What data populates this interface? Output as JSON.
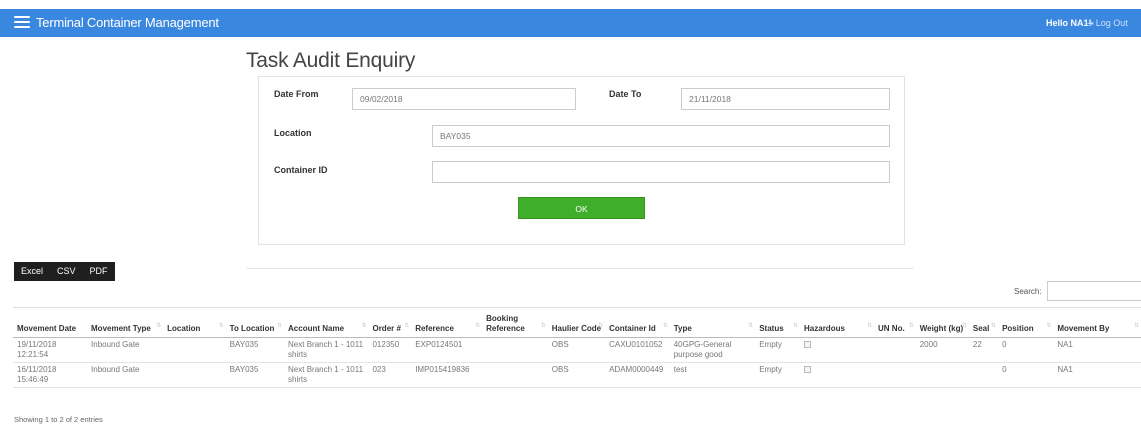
{
  "nav": {
    "brand": "Terminal Container Management",
    "greeting": "Hello NA1!",
    "logout": "Log Out"
  },
  "page": {
    "title": "Task Audit Enquiry"
  },
  "form": {
    "date_from_label": "Date From",
    "date_from_value": "09/02/2018",
    "date_to_label": "Date To",
    "date_to_value": "21/11/2018",
    "location_label": "Location",
    "location_value": "BAY035",
    "container_label": "Container ID",
    "container_value": "",
    "ok_label": "OK"
  },
  "export": {
    "excel": "Excel",
    "csv": "CSV",
    "pdf": "PDF"
  },
  "search": {
    "label": "Search:",
    "value": ""
  },
  "table": {
    "columns": [
      "Movement Date",
      "Movement Type",
      "Location",
      "To Location",
      "Account Name",
      "Order #",
      "Reference",
      "Booking Reference",
      "Haulier Code",
      "Container Id",
      "Type",
      "Status",
      "Hazardous",
      "UN No.",
      "Weight (kg)",
      "Seal",
      "Position",
      "Movement By"
    ],
    "rows": [
      [
        "19/11/2018 12:21:54",
        "Inbound Gate",
        "",
        "BAY035",
        "Next Branch 1 - 1011 shirts",
        "012350",
        "EXP0124501",
        "",
        "OBS",
        "CAXU0101052",
        "40GPG-General purpose good",
        "Empty",
        "",
        "",
        "2000",
        "22",
        "0",
        "NA1"
      ],
      [
        "16/11/2018 15:46:49",
        "Inbound Gate",
        "",
        "BAY035",
        "Next Branch 1 - 1011 shirts",
        "023",
        "IMP015419836",
        "",
        "OBS",
        "ADAM0000449",
        "test",
        "Empty",
        "",
        "",
        "",
        "",
        "0",
        "NA1"
      ]
    ]
  },
  "footer": {
    "info": "Showing 1 to 2 of 2 entries"
  }
}
